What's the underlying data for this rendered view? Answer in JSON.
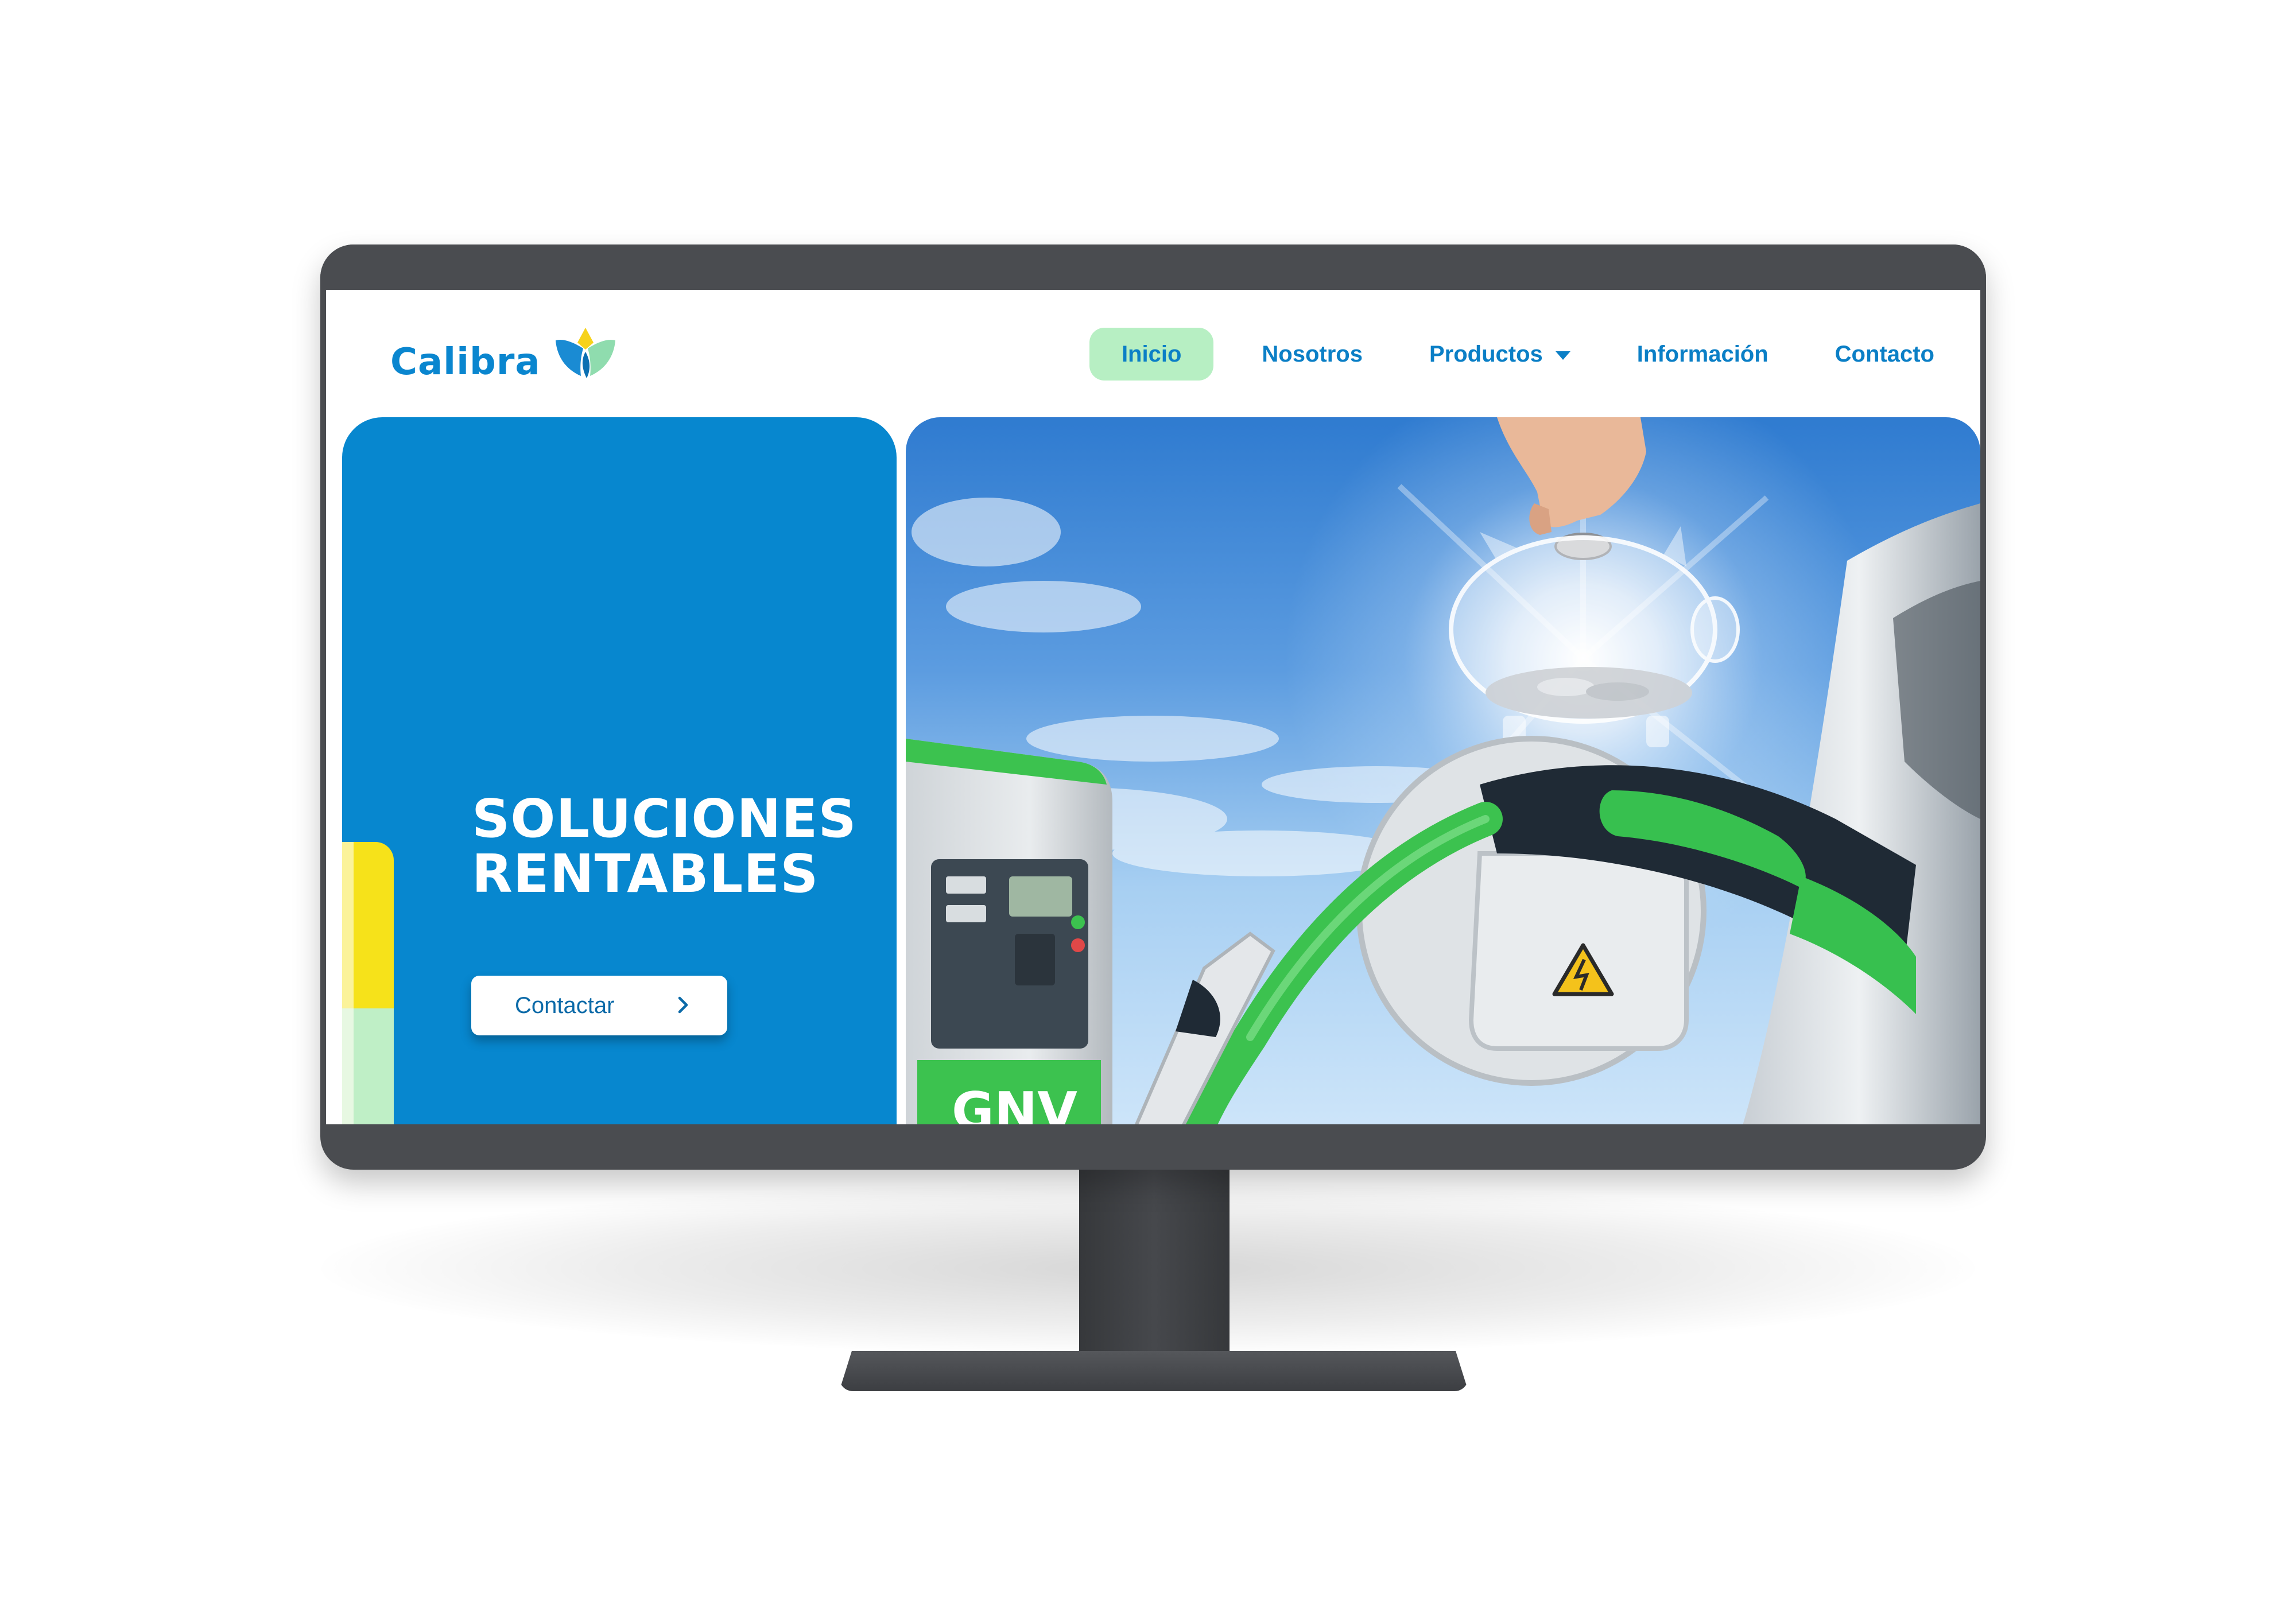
{
  "brand": {
    "name": "Calibra",
    "colors": {
      "primary": "#0787cf",
      "accent_green": "#b7efc3",
      "accent_yellow": "#f6e21a",
      "monitor_frame": "#4a4c50"
    }
  },
  "nav": {
    "items": [
      {
        "label": "Inicio",
        "active": true
      },
      {
        "label": "Nosotros",
        "active": false
      },
      {
        "label": "Productos",
        "active": false,
        "has_dropdown": true
      },
      {
        "label": "Información",
        "active": false
      },
      {
        "label": "Contacto",
        "active": false
      }
    ]
  },
  "hero": {
    "title_line1": "SOLUCIONES",
    "title_line2": "RENTABLES",
    "cta_label": "Contactar",
    "cta_icon": "chevron-right-icon",
    "image_label": "GNV"
  }
}
